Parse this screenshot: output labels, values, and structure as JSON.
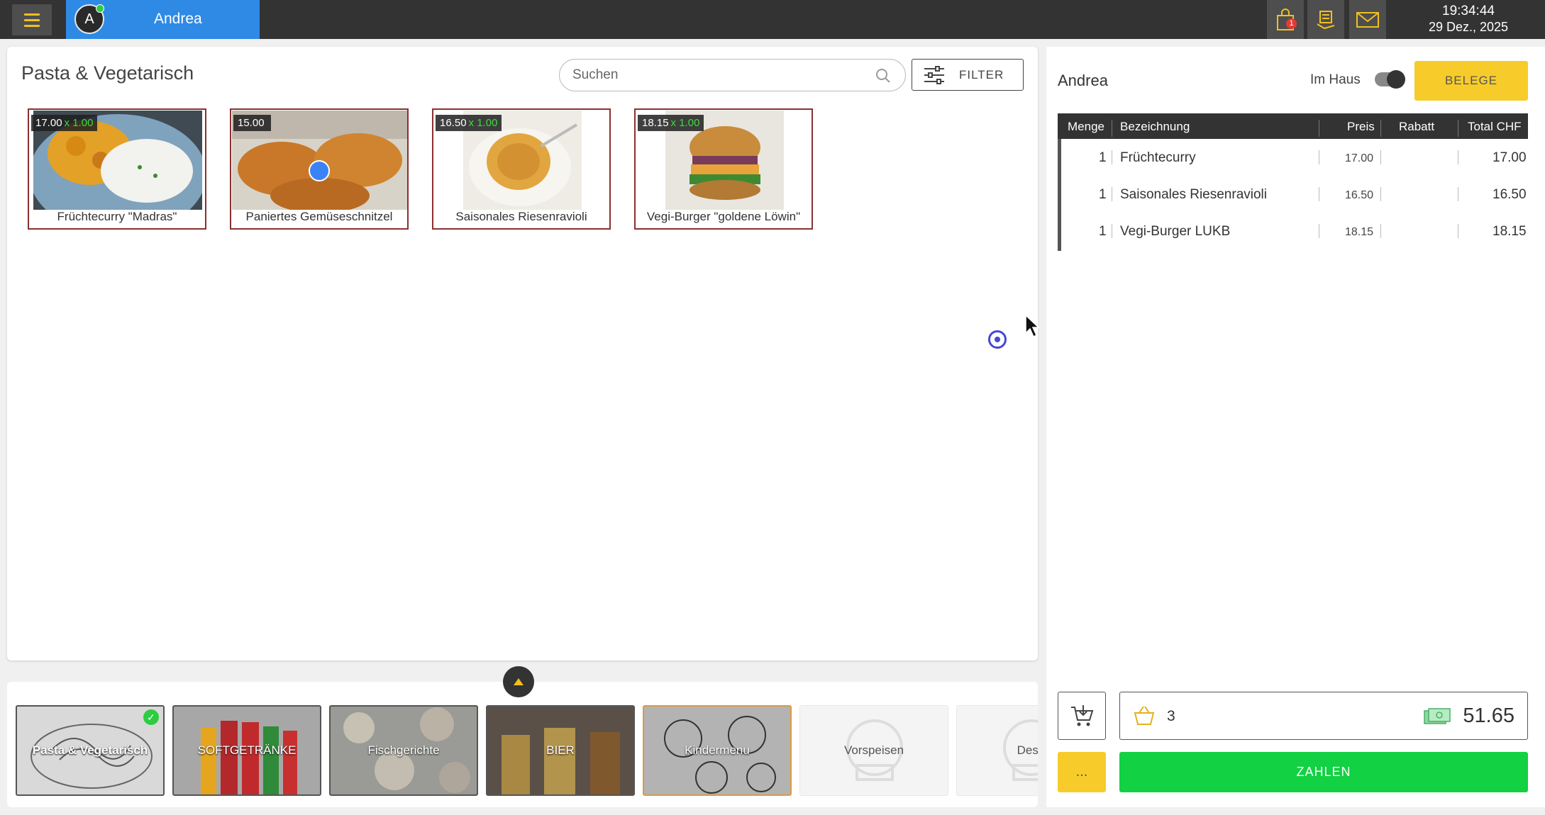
{
  "header": {
    "user_initial": "A",
    "user_name": "Andrea",
    "notification_count": "1",
    "time": "19:34:44",
    "date": "29 Dez., 2025"
  },
  "catalog": {
    "title": "Pasta & Vegetarisch",
    "search_placeholder": "Suchen",
    "filter_label": "FILTER",
    "products": [
      {
        "price": "17.00",
        "qty": "x 1.00",
        "name": "Früchtecurry \"Madras\""
      },
      {
        "price": "15.00",
        "qty": "",
        "name": "Paniertes Gemüseschnitzel"
      },
      {
        "price": "16.50",
        "qty": "x 1.00",
        "name": "Saisonales Riesenravioli"
      },
      {
        "price": "18.15",
        "qty": "x 1.00",
        "name": "Vegi-Burger \"goldene Löwin\""
      }
    ]
  },
  "categories": [
    {
      "label": "Pasta & Vegetarisch",
      "selected": true
    },
    {
      "label": "SOFTGETRÄNKE"
    },
    {
      "label": "Fischgerichte"
    },
    {
      "label": "BIER"
    },
    {
      "label": "Kindermenu"
    },
    {
      "label": "Vorspeisen"
    },
    {
      "label": "Dess"
    }
  ],
  "order": {
    "user_name": "Andrea",
    "im_haus_label": "Im Haus",
    "im_haus_on": true,
    "belege_label": "BELEGE",
    "columns": {
      "menge": "Menge",
      "bezeichnung": "Bezeichnung",
      "preis": "Preis",
      "rabatt": "Rabatt",
      "total": "Total CHF"
    },
    "items": [
      {
        "menge": "1",
        "bezeichnung": "Früchtecurry",
        "preis": "17.00",
        "rabatt": "",
        "total": "17.00"
      },
      {
        "menge": "1",
        "bezeichnung": "Saisonales Riesenravioli",
        "preis": "16.50",
        "rabatt": "",
        "total": "16.50"
      },
      {
        "menge": "1",
        "bezeichnung": "Vegi-Burger LUKB",
        "preis": "18.15",
        "rabatt": "",
        "total": "18.15"
      }
    ],
    "item_count": "3",
    "total": "51.65",
    "more_label": "...",
    "pay_label": "ZAHLEN"
  },
  "colors": {
    "accent": "#f7cc2a",
    "pay": "#12d142",
    "user_tab": "#2f8ae5",
    "topbar": "#333333"
  }
}
